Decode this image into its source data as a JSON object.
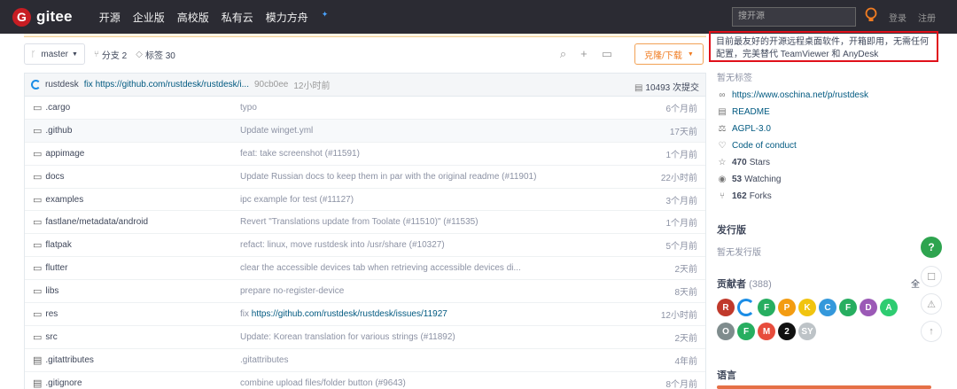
{
  "nav": {
    "logo_letter": "G",
    "brand": "gitee",
    "links": [
      "开源",
      "企业版",
      "高校版",
      "私有云",
      "模力方舟"
    ],
    "spark": "✦",
    "search_placeholder": "搜开源",
    "login": "登录",
    "register": "注册"
  },
  "toolbar": {
    "branch": "master",
    "branches": "分支 2",
    "tags": "标签 30",
    "clone_label": "克隆/下载"
  },
  "commit": {
    "author": "rustdesk",
    "message": "fix https://github.com/rustdesk/rustdesk/i...",
    "sha": "90cb0ee",
    "ago": "12小时前",
    "count": "10493 次提交"
  },
  "files": [
    {
      "name": ".cargo",
      "type": "dir",
      "message": "typo",
      "link": "",
      "time": "6个月前"
    },
    {
      "name": ".github",
      "type": "dir",
      "message": "Update winget.yml",
      "link": "",
      "time": "17天前"
    },
    {
      "name": "appimage",
      "type": "dir",
      "message": "feat: take screenshot (#11591)",
      "link": "",
      "time": "1个月前"
    },
    {
      "name": "docs",
      "type": "dir",
      "message": "Update Russian docs to keep them in par with the original readme (#11901)",
      "link": "",
      "time": "22小时前"
    },
    {
      "name": "examples",
      "type": "dir",
      "message": "ipc example for test (#11127)",
      "link": "",
      "time": "3个月前"
    },
    {
      "name": "fastlane/metadata/android",
      "type": "dir",
      "message": "Revert \"Translations update from Toolate (#11510)\" (#11535)",
      "link": "",
      "time": "1个月前"
    },
    {
      "name": "flatpak",
      "type": "dir",
      "message": "refact: linux, move rustdesk into /usr/share (#10327)",
      "link": "",
      "time": "5个月前"
    },
    {
      "name": "flutter",
      "type": "dir",
      "message": "clear the accessible devices tab when retrieving accessible devices di...",
      "link": "",
      "time": "2天前"
    },
    {
      "name": "libs",
      "type": "dir",
      "message": "prepare no-register-device",
      "link": "",
      "time": "8天前"
    },
    {
      "name": "res",
      "type": "dir",
      "message": "fix ",
      "link": "https://github.com/rustdesk/rustdesk/issues/11927",
      "time": "12小时前"
    },
    {
      "name": "src",
      "type": "dir",
      "message": "Update: Korean translation for various strings (#11892)",
      "link": "",
      "time": "2天前"
    },
    {
      "name": ".gitattributes",
      "type": "file",
      "message": ".gitattributes",
      "link": "",
      "time": "4年前"
    },
    {
      "name": ".gitignore",
      "type": "file",
      "message": "combine upload files/folder button (#9643)",
      "link": "",
      "time": "8个月前"
    }
  ],
  "sidebar": {
    "description": "目前最友好的开源远程桌面软件，开箱即用，无需任何配置，完美替代 TeamViewer 和 AnyDesk",
    "no_tags": "暂无标签",
    "homepage": "https://www.oschina.net/p/rustdesk",
    "readme": "README",
    "license": "AGPL-3.0",
    "conduct": "Code of conduct",
    "stars_count": "470",
    "stars_label": "Stars",
    "watching_count": "53",
    "watching_label": "Watching",
    "forks_count": "162",
    "forks_label": "Forks",
    "releases_title": "发行版",
    "no_releases": "暂无发行版",
    "contributors_title": "贡献者",
    "contributors_count": "(388)",
    "contributors_all": "全",
    "language_title": "语言"
  },
  "avatars": [
    {
      "letter": "R",
      "color": "#c0392b"
    },
    {
      "letter": "",
      "color": "#1b8de6"
    },
    {
      "letter": "F",
      "color": "#27ae60"
    },
    {
      "letter": "P",
      "color": "#f39c12"
    },
    {
      "letter": "K",
      "color": "#f1c40f"
    },
    {
      "letter": "C",
      "color": "#3498db"
    },
    {
      "letter": "F",
      "color": "#27ae60"
    },
    {
      "letter": "D",
      "color": "#9b59b6"
    },
    {
      "letter": "A",
      "color": "#2ecc71"
    },
    {
      "letter": "O",
      "color": "#7f8c8d"
    },
    {
      "letter": "F",
      "color": "#27ae60"
    },
    {
      "letter": "M",
      "color": "#e74c3c"
    },
    {
      "letter": "2",
      "color": "#111111"
    },
    {
      "letter": "SY",
      "color": "#bdc3c7"
    }
  ],
  "colors": {
    "accent": "#f07c22",
    "link": "#005980",
    "highlight": "#e0101a",
    "help": "#2ea44f"
  },
  "floats": {
    "help": "?",
    "comment": "☐",
    "warning": "⚠",
    "top": "↑"
  }
}
